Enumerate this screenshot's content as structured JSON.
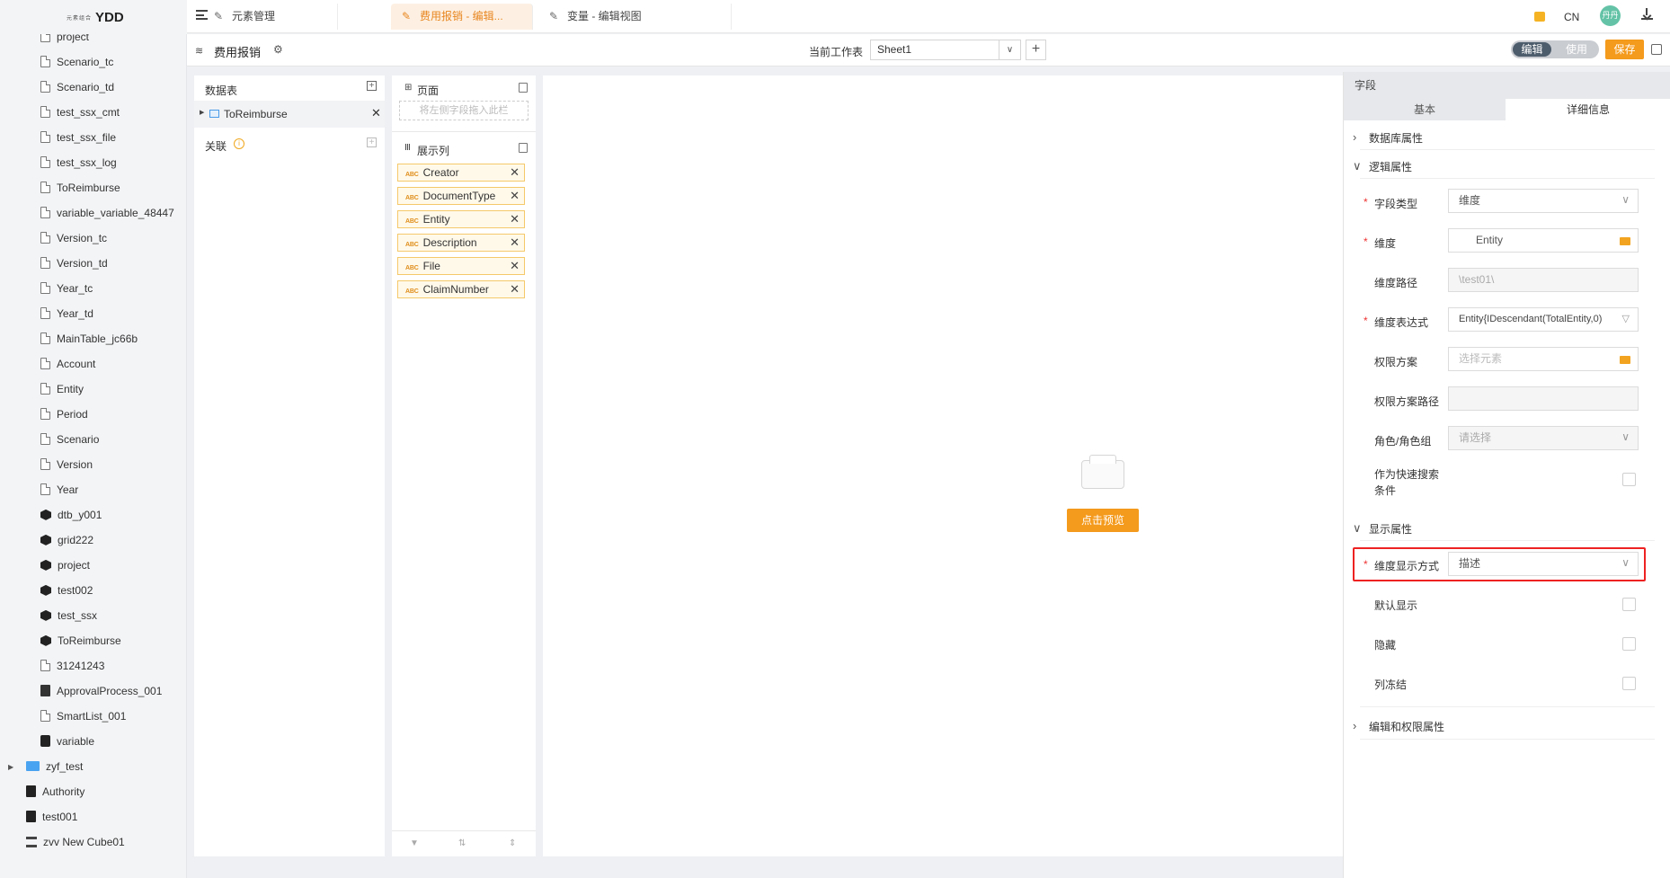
{
  "app": {
    "logo_mark": "元素组合",
    "name": "YDD"
  },
  "sidebar": {
    "items": [
      {
        "label": "project",
        "icon": "file-icon"
      },
      {
        "label": "Scenario_tc",
        "icon": "file-icon"
      },
      {
        "label": "Scenario_td",
        "icon": "file-icon"
      },
      {
        "label": "test_ssx_cmt",
        "icon": "file-icon"
      },
      {
        "label": "test_ssx_file",
        "icon": "file-icon"
      },
      {
        "label": "test_ssx_log",
        "icon": "file-icon"
      },
      {
        "label": "ToReimburse",
        "icon": "file-icon"
      },
      {
        "label": "variable_variable_48447",
        "icon": "file-icon"
      },
      {
        "label": "Version_tc",
        "icon": "file-icon"
      },
      {
        "label": "Version_td",
        "icon": "file-icon"
      },
      {
        "label": "Year_tc",
        "icon": "file-icon"
      },
      {
        "label": "Year_td",
        "icon": "file-icon"
      },
      {
        "label": "MainTable_jc66b",
        "icon": "file-icon"
      },
      {
        "label": "Account",
        "icon": "file-icon"
      },
      {
        "label": "Entity",
        "icon": "file-icon"
      },
      {
        "label": "Period",
        "icon": "file-icon"
      },
      {
        "label": "Scenario",
        "icon": "file-icon"
      },
      {
        "label": "Version",
        "icon": "file-icon"
      },
      {
        "label": "Year",
        "icon": "file-icon"
      },
      {
        "label": "dtb_y001",
        "icon": "cube-icon"
      },
      {
        "label": "grid222",
        "icon": "cube-icon"
      },
      {
        "label": "project",
        "icon": "cube-icon"
      },
      {
        "label": "test002",
        "icon": "cube-icon"
      },
      {
        "label": "test_ssx",
        "icon": "cube-icon"
      },
      {
        "label": "ToReimburse",
        "icon": "cube-icon"
      },
      {
        "label": "31241243",
        "icon": "file-icon"
      },
      {
        "label": "ApprovalProcess_001",
        "icon": "approval-icon"
      },
      {
        "label": "SmartList_001",
        "icon": "file-icon"
      },
      {
        "label": "variable",
        "icon": "variable-icon"
      }
    ],
    "root_items": [
      {
        "label": "zyf_test",
        "icon": "folder-icon"
      },
      {
        "label": "Authority",
        "icon": "document-icon"
      },
      {
        "label": "test001",
        "icon": "document-icon"
      },
      {
        "label": "zvv New Cube01",
        "icon": "hierarchy-icon"
      }
    ]
  },
  "tabs": [
    {
      "label": "元素管理",
      "icon": "tool-icon",
      "active": false
    },
    {
      "label": "费用报销 - 编辑...",
      "icon": "tool-icon",
      "active": true
    },
    {
      "label": "变量 - 编辑视图",
      "icon": "tool-icon",
      "active": false
    }
  ],
  "topright": {
    "lang": "CN",
    "avatar_text": "丹丹"
  },
  "toolbar": {
    "title": "费用报销",
    "sheet_label": "当前工作表",
    "sheet_value": "Sheet1",
    "plus": "+",
    "mode_edit": "编辑",
    "mode_use": "使用",
    "save": "保存"
  },
  "datatable_panel": {
    "title": "数据表",
    "table_name": "ToReimburse",
    "relation_label": "关联"
  },
  "page_panel": {
    "title": "页面",
    "drop_placeholder": "将左侧字段拖入此栏",
    "columns_title": "展示列",
    "columns": [
      "Creator",
      "DocumentType",
      "Entity",
      "Description",
      "File",
      "ClaimNumber"
    ],
    "abc": "ABC"
  },
  "canvas": {
    "preview_button": "点击预览"
  },
  "field_panel": {
    "header": "字段",
    "tab_basic": "基本",
    "tab_detail": "详细信息",
    "section_db": "数据库属性",
    "section_logic": "逻辑属性",
    "field_type_label": "字段类型",
    "field_type_value": "维度",
    "dimension_label": "维度",
    "dimension_value": "Entity",
    "dim_path_label": "维度路径",
    "dim_path_value": "\\test01\\",
    "dim_expr_label": "维度表达式",
    "dim_expr_value": "Entity{IDescendant(TotalEntity,0)",
    "perm_scheme_label": "权限方案",
    "perm_scheme_placeholder": "选择元素",
    "perm_path_label": "权限方案路径",
    "perm_path_value": "",
    "role_label": "角色/角色组",
    "role_placeholder": "请选择",
    "quick_search_label_1": "作为快速搜索",
    "quick_search_label_2": "条件",
    "section_display": "显示属性",
    "dim_display_label": "维度显示方式",
    "dim_display_value": "描述",
    "default_show_label": "默认显示",
    "hide_label": "隐藏",
    "freeze_label": "列冻结",
    "section_edit": "编辑和权限属性"
  },
  "colors": {
    "accent": "#f49a1c",
    "active_tab_bg": "#fdf0e3",
    "highlight": "#e22222"
  }
}
